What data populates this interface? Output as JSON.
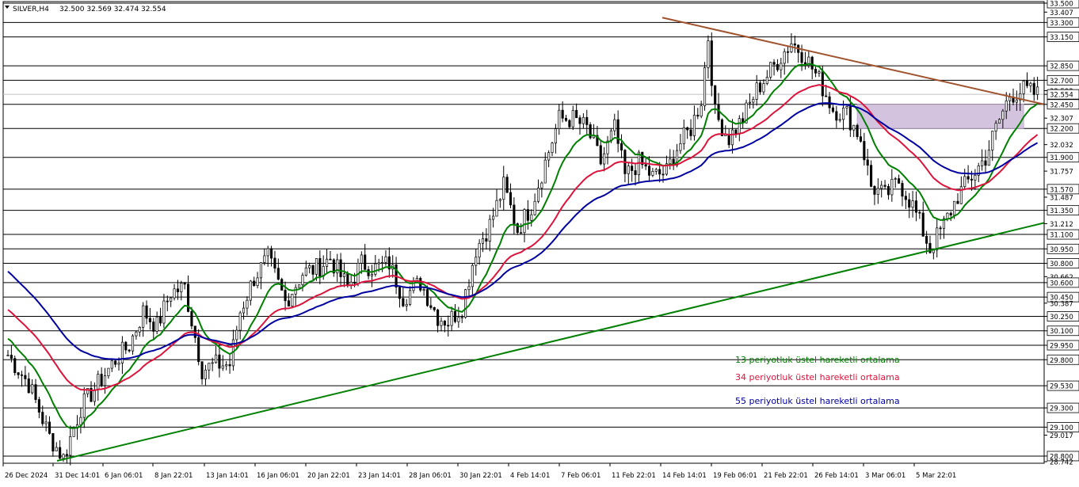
{
  "header": {
    "symbol": "SILVER,H4",
    "ohlc": "32.500 32.569 32.474 32.554"
  },
  "chart_data": {
    "type": "candlestick",
    "ylim": [
      28.742,
      33.5
    ],
    "price_levels": [
      33.5,
      33.3,
      33.15,
      32.85,
      32.7,
      32.554,
      32.45,
      32.2,
      31.9,
      31.57,
      31.35,
      31.1,
      30.95,
      30.8,
      30.6,
      30.45,
      30.25,
      30.1,
      29.95,
      29.8,
      29.53,
      29.3,
      29.1,
      28.8
    ],
    "current_price": 32.554,
    "y_tick_labels": [
      {
        "label": "33.500",
        "value": 33.5,
        "boxed": true
      },
      {
        "label": "33.407",
        "value": 33.407,
        "boxed": false
      },
      {
        "label": "33.300",
        "value": 33.3,
        "boxed": true
      },
      {
        "label": "33.150",
        "value": 33.15,
        "boxed": true
      },
      {
        "label": "32.850",
        "value": 32.85,
        "boxed": true
      },
      {
        "label": "32.700",
        "value": 32.7,
        "boxed": true
      },
      {
        "label": "32.592",
        "value": 32.592,
        "boxed": false
      },
      {
        "label": "32.554",
        "value": 32.554,
        "boxed": true
      },
      {
        "label": "32.450",
        "value": 32.45,
        "boxed": true
      },
      {
        "label": "32.307",
        "value": 32.307,
        "boxed": false
      },
      {
        "label": "32.200",
        "value": 32.2,
        "boxed": true
      },
      {
        "label": "32.032",
        "value": 32.032,
        "boxed": false
      },
      {
        "label": "31.900",
        "value": 31.9,
        "boxed": true
      },
      {
        "label": "31.757",
        "value": 31.757,
        "boxed": false
      },
      {
        "label": "31.570",
        "value": 31.57,
        "boxed": true
      },
      {
        "label": "31.487",
        "value": 31.487,
        "boxed": false
      },
      {
        "label": "31.350",
        "value": 31.35,
        "boxed": true
      },
      {
        "label": "31.212",
        "value": 31.212,
        "boxed": false
      },
      {
        "label": "31.100",
        "value": 31.1,
        "boxed": true
      },
      {
        "label": "30.950",
        "value": 30.95,
        "boxed": true
      },
      {
        "label": "30.800",
        "value": 30.8,
        "boxed": true
      },
      {
        "label": "30.662",
        "value": 30.662,
        "boxed": false
      },
      {
        "label": "30.600",
        "value": 30.6,
        "boxed": true
      },
      {
        "label": "30.450",
        "value": 30.45,
        "boxed": true
      },
      {
        "label": "30.387",
        "value": 30.387,
        "boxed": false
      },
      {
        "label": "30.250",
        "value": 30.25,
        "boxed": true
      },
      {
        "label": "30.100",
        "value": 30.1,
        "boxed": true
      },
      {
        "label": "29.950",
        "value": 29.95,
        "boxed": true
      },
      {
        "label": "29.800",
        "value": 29.8,
        "boxed": true
      },
      {
        "label": "29.530",
        "value": 29.53,
        "boxed": true
      },
      {
        "label": "29.300",
        "value": 29.3,
        "boxed": true
      },
      {
        "label": "29.100",
        "value": 29.1,
        "boxed": true
      },
      {
        "label": "29.017",
        "value": 29.017,
        "boxed": false
      },
      {
        "label": "28.800",
        "value": 28.8,
        "boxed": true
      },
      {
        "label": "28.742",
        "value": 28.742,
        "boxed": false
      }
    ],
    "x_tick_labels": [
      "26 Dec 2024",
      "31 Dec 14:01",
      "6 Jan 06:01",
      "8 Jan 22:01",
      "13 Jan 14:01",
      "16 Jan 06:01",
      "20 Jan 22:01",
      "23 Jan 14:01",
      "28 Jan 06:01",
      "30 Jan 22:01",
      "4 Feb 14:01",
      "7 Feb 06:01",
      "11 Feb 22:01",
      "14 Feb 14:01",
      "19 Feb 06:01",
      "21 Feb 22:01",
      "26 Feb 14:01",
      "3 Mar 06:01",
      "5 Mar 22:01"
    ],
    "candles_anchor_closes": [
      [
        0,
        29.85
      ],
      [
        6,
        29.55
      ],
      [
        12,
        29.0
      ],
      [
        16,
        28.78
      ],
      [
        21,
        29.3
      ],
      [
        26,
        29.55
      ],
      [
        31,
        29.8
      ],
      [
        35,
        29.95
      ],
      [
        39,
        30.3
      ],
      [
        43,
        30.15
      ],
      [
        47,
        30.5
      ],
      [
        51,
        30.55
      ],
      [
        56,
        29.7
      ],
      [
        60,
        29.75
      ],
      [
        64,
        29.75
      ],
      [
        67,
        30.3
      ],
      [
        71,
        30.65
      ],
      [
        75,
        30.85
      ],
      [
        80,
        30.4
      ],
      [
        85,
        30.7
      ],
      [
        89,
        30.75
      ],
      [
        93,
        30.85
      ],
      [
        98,
        30.55
      ],
      [
        102,
        30.8
      ],
      [
        106,
        30.75
      ],
      [
        110,
        30.8
      ],
      [
        114,
        30.45
      ],
      [
        119,
        30.6
      ],
      [
        124,
        30.25
      ],
      [
        127,
        30.2
      ],
      [
        131,
        30.35
      ],
      [
        135,
        30.95
      ],
      [
        139,
        31.2
      ],
      [
        143,
        31.6
      ],
      [
        147,
        31.15
      ],
      [
        151,
        31.4
      ],
      [
        155,
        31.85
      ],
      [
        159,
        32.3
      ],
      [
        163,
        32.3
      ],
      [
        167,
        32.2
      ],
      [
        171,
        31.85
      ],
      [
        175,
        32.2
      ],
      [
        178,
        31.7
      ],
      [
        182,
        31.85
      ],
      [
        186,
        31.7
      ],
      [
        190,
        31.75
      ],
      [
        193,
        32.0
      ],
      [
        197,
        32.2
      ],
      [
        200,
        32.5
      ],
      [
        202,
        33.15
      ],
      [
        204,
        32.35
      ],
      [
        208,
        32.1
      ],
      [
        212,
        32.3
      ],
      [
        216,
        32.6
      ],
      [
        221,
        32.85
      ],
      [
        226,
        33.1
      ],
      [
        230,
        32.95
      ],
      [
        234,
        32.7
      ],
      [
        238,
        32.4
      ],
      [
        242,
        32.35
      ],
      [
        246,
        32.1
      ],
      [
        249,
        31.6
      ],
      [
        253,
        31.5
      ],
      [
        257,
        31.65
      ],
      [
        261,
        31.4
      ],
      [
        266,
        30.95
      ],
      [
        270,
        31.2
      ],
      [
        274,
        31.5
      ],
      [
        278,
        31.7
      ],
      [
        282,
        31.9
      ],
      [
        285,
        32.2
      ],
      [
        289,
        32.55
      ],
      [
        293,
        32.6
      ],
      [
        297,
        32.55
      ]
    ],
    "candle_count": 298,
    "series": [
      {
        "name": "13 periyotluk üstel hareketli ortalama",
        "period": 13,
        "color": "#008000"
      },
      {
        "name": "34 periyotluk üstel hareketli ortalama",
        "period": 34,
        "color": "#dc143c"
      },
      {
        "name": "55 periyotluk üstel hareketli ortalama",
        "period": 55,
        "color": "#0000a0"
      }
    ],
    "trendlines": [
      {
        "role": "rising-support",
        "color": "#008000",
        "from": [
          "31 Dec 2024",
          28.75
        ],
        "to": [
          "5 Mar 2025",
          31.2
        ],
        "extends_to_edge": true
      },
      {
        "role": "falling-resistance",
        "color": "#a0522d",
        "from": [
          "13 Feb 2025",
          33.35
        ],
        "to": [
          "5 Mar 2025",
          32.68
        ],
        "extends_to_edge": true
      }
    ],
    "resistance_zone": {
      "from": "21 Feb 2025",
      "to": "6 Mar 2025",
      "low": 32.2,
      "high": 32.45,
      "color": "#c8b4d7"
    },
    "colors": {
      "bull": "#000000",
      "bear": "#000000",
      "grid": "#000000",
      "ask_line": "#c0c0c0"
    }
  }
}
